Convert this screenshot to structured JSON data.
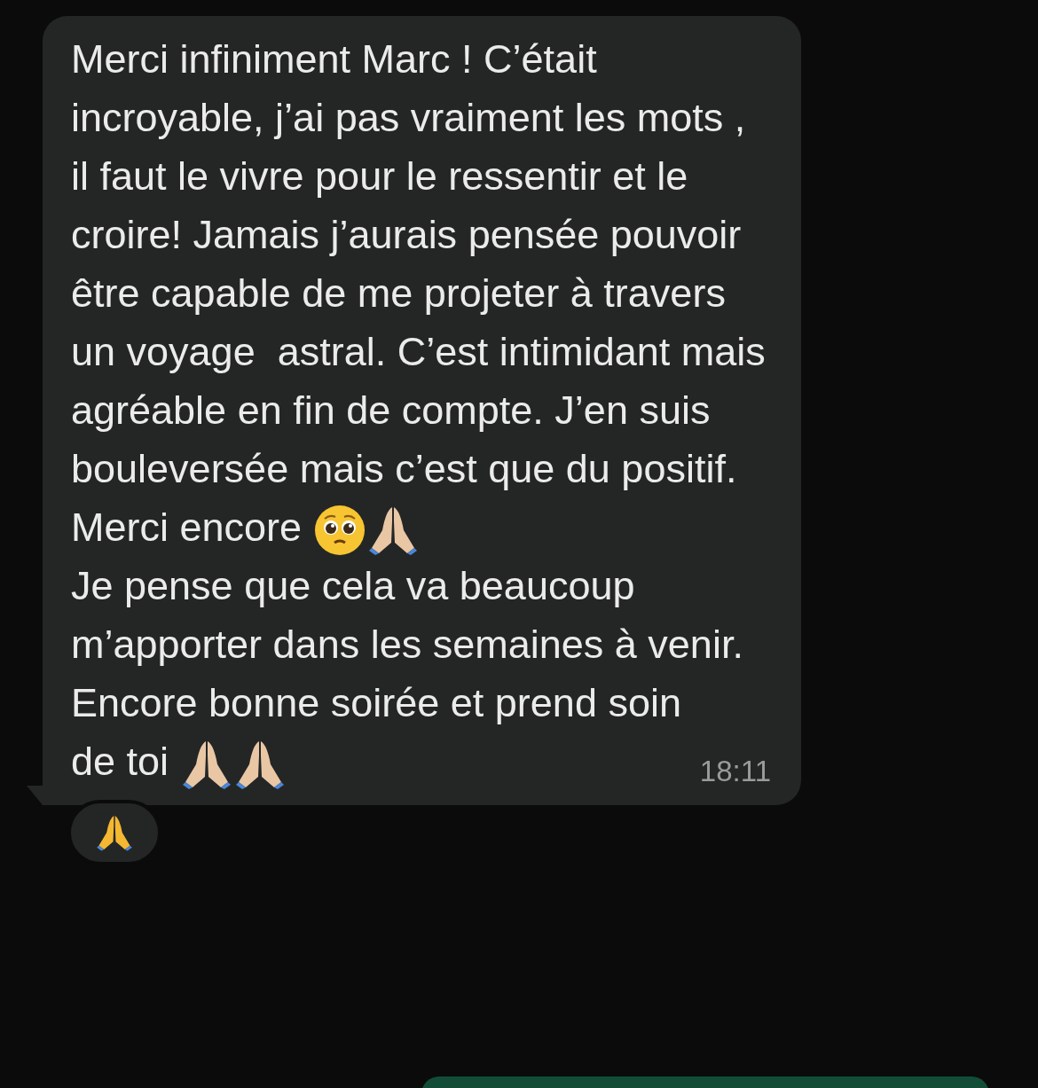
{
  "message": {
    "paragraphs": [
      {
        "text": "Merci infiniment Marc ! C’était incroyable, j’ai pas vraiment les mots , il faut le vivre pour le ressentir et le croire! Jamais j’aurais pensée pouvoir être capable de me projeter à travers un voyage  astral. C’est intimidant mais agréable en fin de compte. J’en suis bouleversée mais c’est que du positif."
      },
      {
        "text": "Merci encore",
        "emojis": [
          {
            "kind": "pleading-face"
          },
          {
            "kind": "praying-hands"
          }
        ]
      },
      {
        "text": "Je pense que cela va beaucoup m’apporter dans les semaines à venir."
      },
      {
        "text": "Encore bonne soirée et prend soin de toi",
        "emojis": [
          {
            "kind": "praying-hands"
          },
          {
            "kind": "praying-hands"
          }
        ]
      }
    ],
    "time": "18:11"
  },
  "reaction": {
    "kind": "praying-hands"
  },
  "next_message": {
    "kind": "outgoing"
  }
}
